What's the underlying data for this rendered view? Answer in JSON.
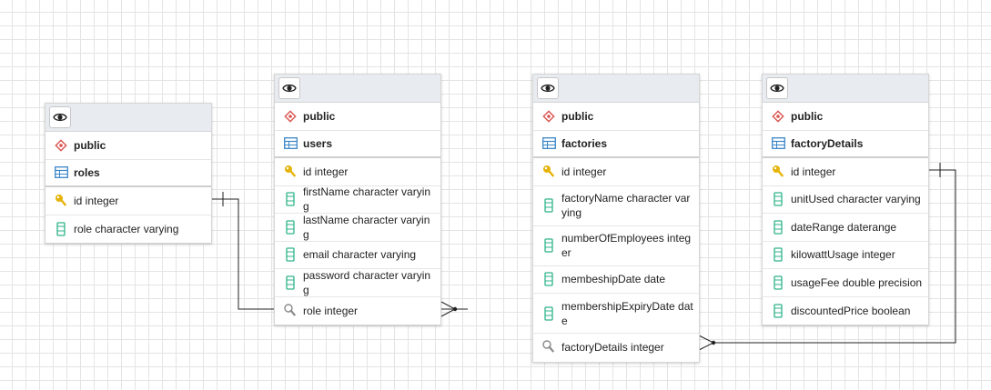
{
  "tables": [
    {
      "id": "roles",
      "schema": "public",
      "name": "roles",
      "columns": [
        {
          "text": "id integer",
          "icon": "key-icon"
        },
        {
          "text": "role character varying",
          "icon": "column-icon"
        }
      ]
    },
    {
      "id": "users",
      "schema": "public",
      "name": "users",
      "columns": [
        {
          "text": "id integer",
          "icon": "key-icon"
        },
        {
          "text": "firstName character varying",
          "icon": "column-icon"
        },
        {
          "text": "lastName character varying",
          "icon": "column-icon"
        },
        {
          "text": "email character varying",
          "icon": "column-icon"
        },
        {
          "text": "password character varying",
          "icon": "column-icon"
        },
        {
          "text": "role integer",
          "icon": "foreign-key-icon"
        }
      ]
    },
    {
      "id": "factories",
      "schema": "public",
      "name": "factories",
      "columns": [
        {
          "text": "id integer",
          "icon": "key-icon"
        },
        {
          "text": "factoryName character varying",
          "icon": "column-icon"
        },
        {
          "text": "numberOfEmployees integer",
          "icon": "column-icon"
        },
        {
          "text": "membeshipDate date",
          "icon": "column-icon"
        },
        {
          "text": "membershipExpiryDate date",
          "icon": "column-icon"
        },
        {
          "text": "factoryDetails integer",
          "icon": "foreign-key-icon"
        }
      ]
    },
    {
      "id": "factoryDetails",
      "schema": "public",
      "name": "factoryDetails",
      "columns": [
        {
          "text": "id integer",
          "icon": "key-icon"
        },
        {
          "text": "unitUsed character varying",
          "icon": "column-icon"
        },
        {
          "text": "dateRange daterange",
          "icon": "column-icon"
        },
        {
          "text": "kilowattUsage integer",
          "icon": "column-icon"
        },
        {
          "text": "usageFee double precision",
          "icon": "column-icon"
        },
        {
          "text": "discountedPrice boolean",
          "icon": "column-icon"
        }
      ]
    }
  ],
  "relationships": [
    {
      "from": "users.role",
      "to": "roles.id",
      "cardinality": "many-to-one"
    },
    {
      "from": "factories.factoryDetails",
      "to": "factoryDetails.id",
      "cardinality": "many-to-one"
    }
  ],
  "colors": {
    "header": "#e8ebef",
    "schema_icon": "#d9534f",
    "table_icon": "#3a86c8",
    "key_icon": "#e5b40b",
    "column_icon": "#2fb38a",
    "fk_icon": "#8a8a8a"
  }
}
